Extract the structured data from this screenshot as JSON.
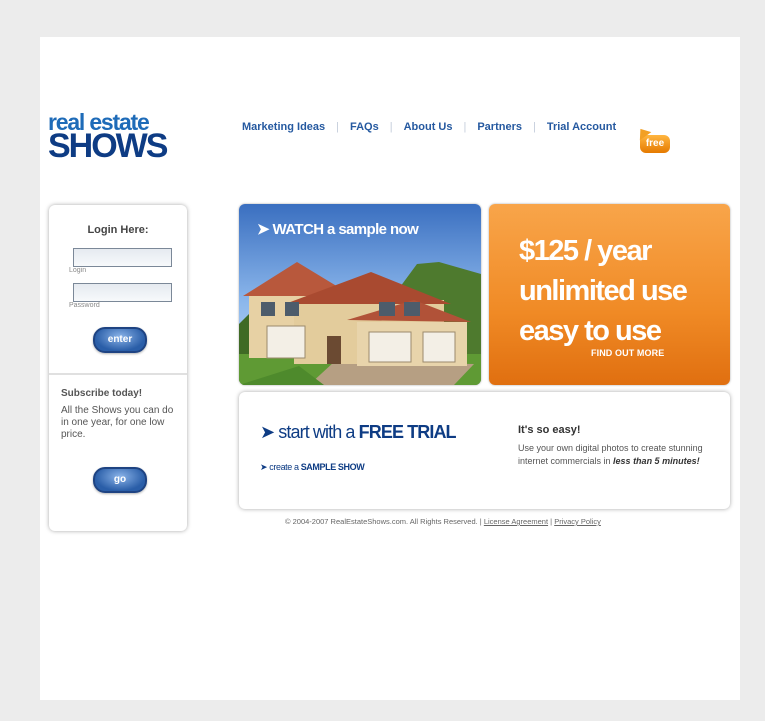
{
  "logo": {
    "line1": "real estate",
    "line2": "SHOWS"
  },
  "nav": {
    "items": [
      {
        "label": "Marketing Ideas"
      },
      {
        "label": "FAQs"
      },
      {
        "label": "About Us"
      },
      {
        "label": "Partners"
      },
      {
        "label": "Trial Account"
      }
    ],
    "separator": "|",
    "free_badge": "free"
  },
  "login": {
    "title": "Login Here:",
    "login_label": "Login",
    "password_label": "Password",
    "login_value": "",
    "password_value": "",
    "enter_button": "enter"
  },
  "subscribe": {
    "title": "Subscribe today!",
    "text": "All the Shows you can do in one year, for one low price.",
    "go_button": "go"
  },
  "watch": {
    "prefix": "WATCH",
    "suffix": " a sample now",
    "icon": "arrow-right-icon"
  },
  "price": {
    "line1": "$125 / year",
    "line2": "unlimited use",
    "line3": "easy to use",
    "find_out": "FIND OUT MORE"
  },
  "trial": {
    "start_prefix": "start with a ",
    "start_bold": "FREE TRIAL",
    "sample_prefix": "create a ",
    "sample_bold": "SAMPLE SHOW",
    "easy_title": "It's so easy!",
    "easy_text": "Use your own digital photos to create stunning internet commercials in ",
    "easy_em": "less than 5 minutes!"
  },
  "footer": {
    "copyright": "© 2004-2007 RealEstateShows.com. All Rights Reserved.",
    "sep": " | ",
    "license": "License Agreement",
    "privacy": "Privacy Policy"
  },
  "colors": {
    "brand_blue": "#0e3c84",
    "accent_orange": "#f08a25",
    "link_blue": "#2559a0"
  }
}
